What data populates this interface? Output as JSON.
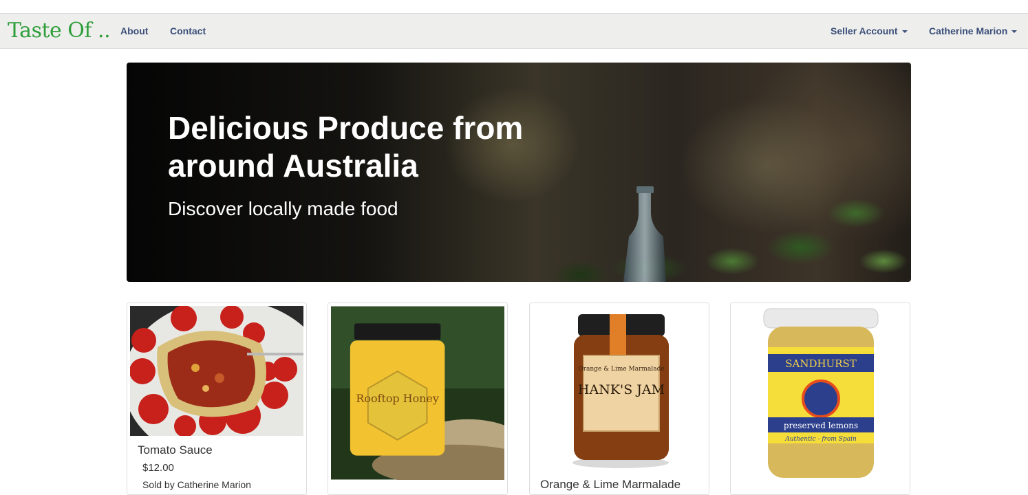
{
  "navbar": {
    "brand": "Taste Of ..",
    "links": [
      {
        "label": "About"
      },
      {
        "label": "Contact"
      }
    ],
    "seller_account": "Seller Account",
    "user_name": "Catherine Marion",
    "colors": {
      "brand": "#2e9e3a",
      "link": "#3b4f7a",
      "bar": "#eeeeec"
    }
  },
  "hero": {
    "title": "Delicious Produce from around Australia",
    "subtitle": "Discover locally made food"
  },
  "products": [
    {
      "name": "Tomato Sauce",
      "price": "$12.00",
      "seller": "Sold by Catherine Marion",
      "image": "tomato-sauce-photo"
    },
    {
      "name": "",
      "price": "",
      "seller": "",
      "image": "rooftop-honey-jar-photo"
    },
    {
      "name": "Orange & Lime Marmalade",
      "price": "",
      "seller": "",
      "image": "hanks-jam-jar-photo"
    },
    {
      "name": "",
      "price": "",
      "seller": "",
      "image": "preserved-lemons-jar-photo"
    }
  ],
  "product_image_text": {
    "honey_label": "Rooftop Honey",
    "jam_label_top": "Orange & Lime Marmalade",
    "jam_brand": "HANK'S JAM",
    "lemons_brand": "SANDHURST",
    "lemons_label": "preserved lemons",
    "lemons_tagline": "Authentic - from Spain"
  }
}
